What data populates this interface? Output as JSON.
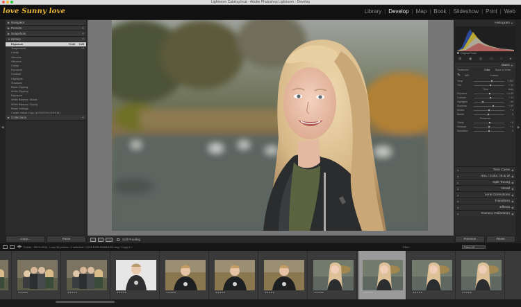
{
  "window": {
    "title": "Lightroom Catalog.lrcat - Adobe Photoshop Lightroom - Develop"
  },
  "identity_plate": "love Sunny love",
  "modules": [
    {
      "label": "Library",
      "active": false
    },
    {
      "label": "Develop",
      "active": true
    },
    {
      "label": "Map",
      "active": false
    },
    {
      "label": "Book",
      "active": false
    },
    {
      "label": "Slideshow",
      "active": false
    },
    {
      "label": "Print",
      "active": false
    },
    {
      "label": "Web",
      "active": false
    }
  ],
  "left_panel": {
    "navigator": "Navigator",
    "presets": "Presets",
    "snapshots": "Snapshots",
    "history": "History",
    "collections": "Collections",
    "history_items": [
      {
        "label": "Exposure",
        "v1": "+0.40",
        "v2": "0.25",
        "selected": true
      },
      {
        "label": "Temperature",
        "v1": "",
        "v2": "+6",
        "selected": false
      },
      {
        "label": "Clarity",
        "v1": "",
        "v2": "",
        "selected": false
      },
      {
        "label": "Vibrance",
        "v1": "",
        "v2": "",
        "selected": false
      },
      {
        "label": "Vibrance",
        "v1": "",
        "v2": "",
        "selected": false
      },
      {
        "label": "Clarity",
        "v1": "",
        "v2": "",
        "selected": false
      },
      {
        "label": "Exposure",
        "v1": "",
        "v2": "",
        "selected": false
      },
      {
        "label": "Contrast",
        "v1": "",
        "v2": "",
        "selected": false
      },
      {
        "label": "Highlights",
        "v1": "",
        "v2": "",
        "selected": false
      },
      {
        "label": "Shadows",
        "v1": "",
        "v2": "",
        "selected": false
      },
      {
        "label": "Black Clipping",
        "v1": "",
        "v2": "",
        "selected": false
      },
      {
        "label": "White Clipping",
        "v1": "",
        "v2": "",
        "selected": false
      },
      {
        "label": "Exposure",
        "v1": "",
        "v2": "",
        "selected": false
      },
      {
        "label": "White Balance: Shade",
        "v1": "",
        "v2": "",
        "selected": false
      },
      {
        "label": "White Balance: Cloudy",
        "v1": "",
        "v2": "",
        "selected": false
      },
      {
        "label": "Reset Settings",
        "v1": "",
        "v2": "",
        "selected": false
      },
      {
        "label": "Create Virtual Copy (11/11/2019 13:04:41)",
        "v1": "",
        "v2": "",
        "selected": false
      }
    ],
    "copy_button": "Copy...",
    "paste_button": "Paste"
  },
  "toolbar": {
    "soft_proofing": "Soft Proofing"
  },
  "right_panel": {
    "histogram": "Histogram",
    "original_photo": "Original Photo",
    "basic": "Basic",
    "treatment_label": "Treatment :",
    "color": "Color",
    "bw": "Black & White",
    "wb_label": "WB :",
    "wb_value": "Custom",
    "tone_label": "Tone",
    "auto": "Auto",
    "presence_label": "Presence",
    "sliders_wb": [
      {
        "label": "Temp",
        "value": "7,362",
        "pos": 0.6
      },
      {
        "label": "Tint",
        "value": "+ 12",
        "pos": 0.55
      }
    ],
    "sliders_tone": [
      {
        "label": "Exposure",
        "value": "+ 0.25",
        "pos": 0.53
      },
      {
        "label": "Contrast",
        "value": "+ 11",
        "pos": 0.56
      },
      {
        "label": "Highlights",
        "value": "- 40",
        "pos": 0.3
      },
      {
        "label": "Shadows",
        "value": "+ 30",
        "pos": 0.65
      },
      {
        "label": "Whites",
        "value": "+ 4",
        "pos": 0.52
      },
      {
        "label": "Blacks",
        "value": "- 5",
        "pos": 0.48
      }
    ],
    "sliders_presence": [
      {
        "label": "Clarity",
        "value": "+ 5",
        "pos": 0.53
      },
      {
        "label": "Vibrance",
        "value": "+ 4",
        "pos": 0.52
      },
      {
        "label": "Saturation",
        "value": "0",
        "pos": 0.5
      }
    ],
    "sections": [
      "Tone Curve",
      "HSL / Color / B & W",
      "Split Toning",
      "Detail",
      "Lens Corrections",
      "Transform",
      "Effects",
      "Camera Calibration"
    ],
    "previous_button": "Previous",
    "reset_button": "Reset"
  },
  "filmstrip_bar": {
    "breadcrumb": "Folder : 2013-1205 - Lucy    35 photos / 1 selected / 2013-1205-SUBA2329.dng / Copy 8 +",
    "filter_label": "Filter :",
    "filter_value": "Filters Off"
  },
  "filmstrip": {
    "thumbs": [
      {
        "kind": "group",
        "selected": false
      },
      {
        "kind": "group",
        "selected": false
      },
      {
        "kind": "group",
        "selected": false
      },
      {
        "kind": "boy-light",
        "selected": false
      },
      {
        "kind": "boy-dark",
        "selected": false
      },
      {
        "kind": "boy-dark",
        "selected": false
      },
      {
        "kind": "boy-dark",
        "selected": false
      },
      {
        "kind": "girl",
        "selected": false
      },
      {
        "kind": "girl",
        "selected": true
      },
      {
        "kind": "girl",
        "selected": false
      },
      {
        "kind": "girl",
        "selected": false
      }
    ],
    "stars": "★★★★★"
  },
  "colors": {
    "accent": "#e9b53a",
    "panel": "#2b2b2b",
    "center": "#777777"
  }
}
